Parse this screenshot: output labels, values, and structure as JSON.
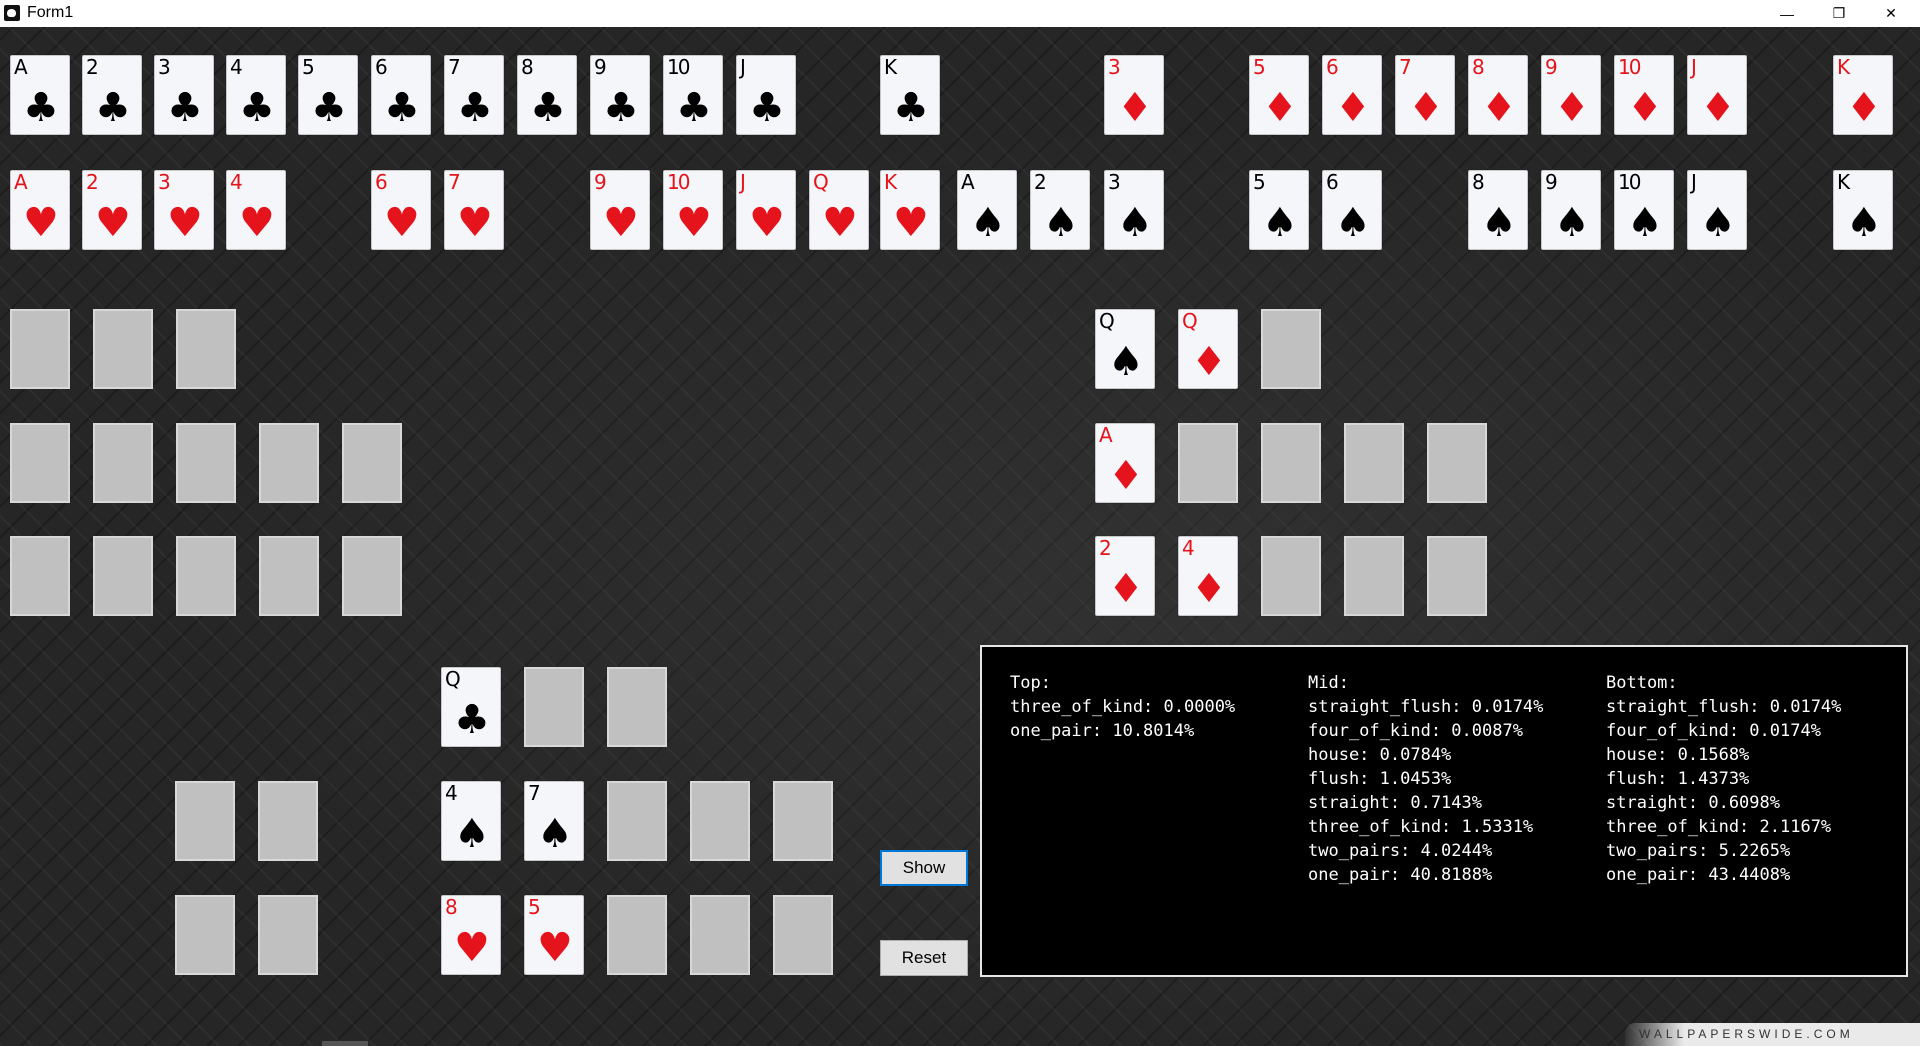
{
  "window": {
    "title": "Form1",
    "minimize_label": "—",
    "restore_label": "❐",
    "close_label": "✕"
  },
  "deck_row1": [
    {
      "rank": "A",
      "suit": "♣",
      "color": "black"
    },
    {
      "rank": "2",
      "suit": "♣",
      "color": "black"
    },
    {
      "rank": "3",
      "suit": "♣",
      "color": "black"
    },
    {
      "rank": "4",
      "suit": "♣",
      "color": "black"
    },
    {
      "rank": "5",
      "suit": "♣",
      "color": "black"
    },
    {
      "rank": "6",
      "suit": "♣",
      "color": "black"
    },
    {
      "rank": "7",
      "suit": "♣",
      "color": "black"
    },
    {
      "rank": "8",
      "suit": "♣",
      "color": "black"
    },
    {
      "rank": "9",
      "suit": "♣",
      "color": "black"
    },
    {
      "rank": "10",
      "suit": "♣",
      "color": "black"
    },
    {
      "rank": "J",
      "suit": "♣",
      "color": "black"
    },
    {
      "rank": "K",
      "suit": "♣",
      "color": "black"
    },
    {
      "rank": "3",
      "suit": "♦",
      "color": "red"
    },
    {
      "rank": "5",
      "suit": "♦",
      "color": "red"
    },
    {
      "rank": "6",
      "suit": "♦",
      "color": "red"
    },
    {
      "rank": "7",
      "suit": "♦",
      "color": "red"
    },
    {
      "rank": "8",
      "suit": "♦",
      "color": "red"
    },
    {
      "rank": "9",
      "suit": "♦",
      "color": "red"
    },
    {
      "rank": "10",
      "suit": "♦",
      "color": "red"
    },
    {
      "rank": "J",
      "suit": "♦",
      "color": "red"
    },
    {
      "rank": "K",
      "suit": "♦",
      "color": "red"
    }
  ],
  "deck_row2": [
    {
      "rank": "A",
      "suit": "♥",
      "color": "red"
    },
    {
      "rank": "2",
      "suit": "♥",
      "color": "red"
    },
    {
      "rank": "3",
      "suit": "♥",
      "color": "red"
    },
    {
      "rank": "4",
      "suit": "♥",
      "color": "red"
    },
    {
      "rank": "6",
      "suit": "♥",
      "color": "red"
    },
    {
      "rank": "7",
      "suit": "♥",
      "color": "red"
    },
    {
      "rank": "9",
      "suit": "♥",
      "color": "red"
    },
    {
      "rank": "10",
      "suit": "♥",
      "color": "red"
    },
    {
      "rank": "J",
      "suit": "♥",
      "color": "red"
    },
    {
      "rank": "Q",
      "suit": "♥",
      "color": "red"
    },
    {
      "rank": "K",
      "suit": "♥",
      "color": "red"
    },
    {
      "rank": "A",
      "suit": "♠",
      "color": "black"
    },
    {
      "rank": "2",
      "suit": "♠",
      "color": "black"
    },
    {
      "rank": "3",
      "suit": "♠",
      "color": "black"
    },
    {
      "rank": "5",
      "suit": "♠",
      "color": "black"
    },
    {
      "rank": "6",
      "suit": "♠",
      "color": "black"
    },
    {
      "rank": "8",
      "suit": "♠",
      "color": "black"
    },
    {
      "rank": "9",
      "suit": "♠",
      "color": "black"
    },
    {
      "rank": "10",
      "suit": "♠",
      "color": "black"
    },
    {
      "rank": "J",
      "suit": "♠",
      "color": "black"
    },
    {
      "rank": "K",
      "suit": "♠",
      "color": "black"
    }
  ],
  "left_hand": {
    "top": [
      null,
      null,
      null
    ],
    "mid": [
      null,
      null,
      null,
      null,
      null
    ],
    "bottom": [
      null,
      null,
      null,
      null,
      null
    ]
  },
  "right_hand": {
    "top": [
      {
        "rank": "Q",
        "suit": "♠",
        "color": "black"
      },
      {
        "rank": "Q",
        "suit": "♦",
        "color": "red"
      },
      null
    ],
    "mid": [
      {
        "rank": "A",
        "suit": "♦",
        "color": "red"
      },
      null,
      null,
      null,
      null
    ],
    "bottom": [
      {
        "rank": "2",
        "suit": "♦",
        "color": "red"
      },
      {
        "rank": "4",
        "suit": "♦",
        "color": "red"
      },
      null,
      null,
      null
    ]
  },
  "player_hand": {
    "top": [
      {
        "rank": "Q",
        "suit": "♣",
        "color": "black"
      },
      null,
      null
    ],
    "mid": [
      {
        "rank": "4",
        "suit": "♠",
        "color": "black"
      },
      {
        "rank": "7",
        "suit": "♠",
        "color": "black"
      },
      null,
      null,
      null
    ],
    "bottom": [
      {
        "rank": "8",
        "suit": "♥",
        "color": "red"
      },
      {
        "rank": "5",
        "suit": "♥",
        "color": "red"
      },
      null,
      null,
      null
    ]
  },
  "extra_slots": [
    null,
    null,
    null,
    null
  ],
  "buttons": {
    "show_label": "Show",
    "reset_label": "Reset"
  },
  "results": {
    "top": [
      "Top:",
      "three_of_kind: 0.0000%",
      "one_pair: 10.8014%"
    ],
    "mid": [
      "Mid:",
      "straight_flush: 0.0174%",
      "four_of_kind: 0.0087%",
      "house: 0.0784%",
      "flush: 1.0453%",
      "straight: 0.7143%",
      "three_of_kind: 1.5331%",
      "two_pairs: 4.0244%",
      "one_pair: 40.8188%"
    ],
    "bottom": [
      "Bottom:",
      "straight_flush: 0.0174%",
      "four_of_kind: 0.0174%",
      "house: 0.1568%",
      "flush: 1.4373%",
      "straight: 0.6098%",
      "three_of_kind: 2.1167%",
      "two_pairs: 5.2265%",
      "one_pair: 43.4408%"
    ]
  },
  "watermark": "WALLPAPERSWIDE.COM",
  "colors": {
    "red_suit": "#e5141c",
    "black_suit": "#000000",
    "slot_gray": "#c0c0c0",
    "accent": "#0078d7"
  }
}
